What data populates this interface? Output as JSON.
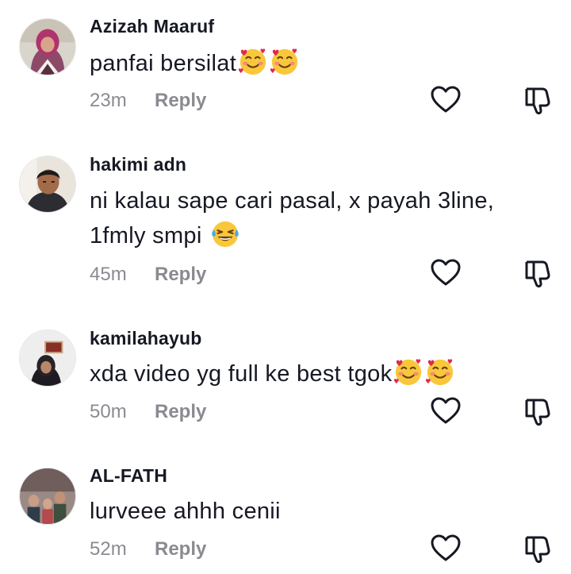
{
  "comments": [
    {
      "username": "Azizah Maaruf",
      "text": "panfai bersilat",
      "emojis": [
        "smiling-face-with-hearts",
        "smiling-face-with-hearts"
      ],
      "time": "23m",
      "reply": "Reply"
    },
    {
      "username": "hakimi adn",
      "text_line1": "ni kalau sape cari pasal, x payah 3line,",
      "text_line2": "1fmly smpi",
      "emojis": [
        "face-with-tears-of-joy"
      ],
      "time": "45m",
      "reply": "Reply"
    },
    {
      "username": "kamilahayub",
      "text": "xda video yg full ke best tgok",
      "emojis": [
        "smiling-face-with-hearts",
        "smiling-face-with-hearts"
      ],
      "time": "50m",
      "reply": "Reply"
    },
    {
      "username": "AL-FATH",
      "text": "lurveee ahhh cenii",
      "time": "52m",
      "reply": "Reply"
    }
  ],
  "icons": {
    "like": "heart-outline-icon",
    "dislike": "thumbs-down-outline-icon"
  },
  "colors": {
    "text": "#161823",
    "meta": "#8a8b91",
    "background": "#ffffff"
  }
}
